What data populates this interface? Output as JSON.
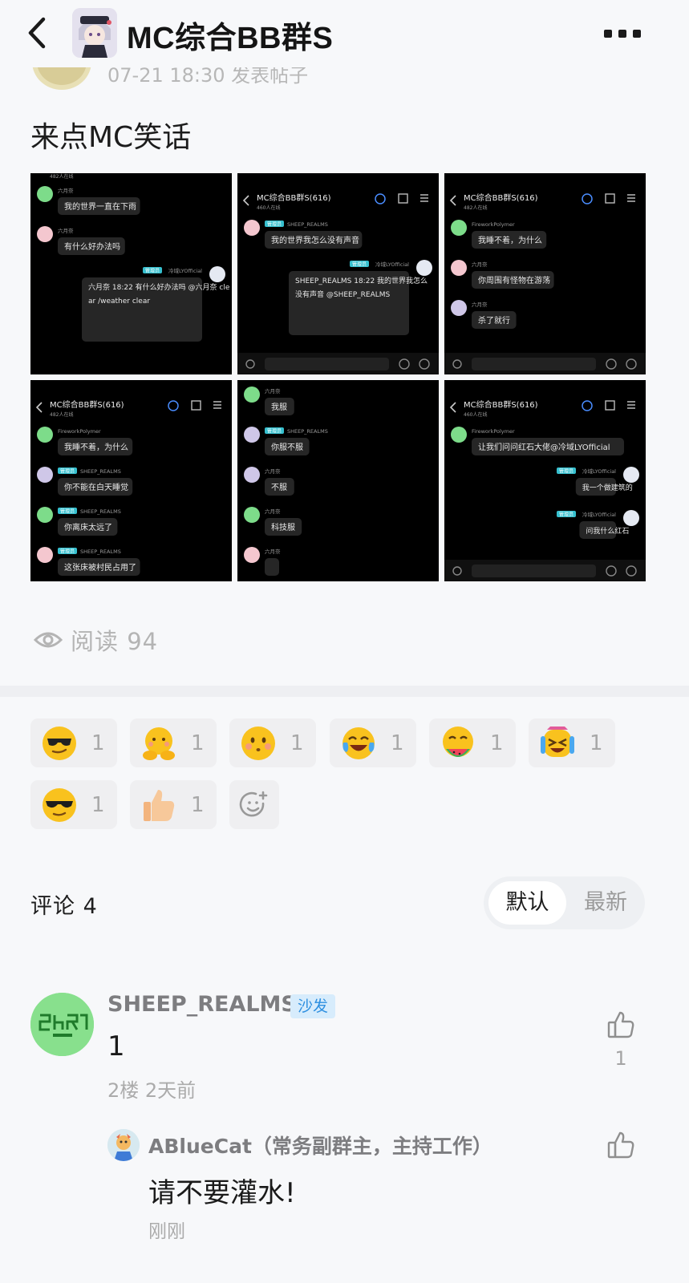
{
  "header": {
    "title": "MC综合BB群S",
    "back_icon": "chevron-left-icon",
    "more_icon": "more-dots-icon"
  },
  "post": {
    "time_partial": "07-21 18:30 发表帖子",
    "title": "来点MC笑话",
    "read_icon": "eye-icon",
    "read_label": "阅读 94",
    "screenshots": [
      {
        "chat_title": "",
        "online": "482人在线",
        "messages": [
          {
            "side": "left",
            "tag": "",
            "sender": "六月奈",
            "text": "我的世界一直在下雨"
          },
          {
            "side": "left",
            "tag": "",
            "sender": "六月奈",
            "text": "有什么好办法吗"
          },
          {
            "side": "right",
            "tag": "管理员",
            "sender": "冷域LYOfficial",
            "text": "六月奈 18:22 有什么好办法吗 @六月奈 clear /weather clear"
          }
        ]
      },
      {
        "chat_title": "MC综合BB群S(616)",
        "online": "460人在线",
        "messages": [
          {
            "side": "left",
            "tag": "管理员",
            "sender": "SHEEP_REALMS",
            "text": "我的世界我怎么没有声音"
          },
          {
            "side": "right",
            "tag": "管理员",
            "sender": "冷域LYOfficial",
            "text": "SHEEP_REALMS 18:22 我的世界我怎么没有声音 @SHEEP_REALMS"
          }
        ]
      },
      {
        "chat_title": "MC综合BB群S(616)",
        "online": "482人在线",
        "messages": [
          {
            "side": "left",
            "tag": "",
            "sender": "FireworkPolymer",
            "text": "我睡不着，为什么"
          },
          {
            "side": "left",
            "tag": "",
            "sender": "六月奈",
            "text": "你周围有怪物在游荡"
          },
          {
            "side": "left",
            "tag": "",
            "sender": "六月奈",
            "text": "杀了就行"
          }
        ]
      },
      {
        "chat_title": "MC综合BB群S(616)",
        "online": "482人在线",
        "messages": [
          {
            "side": "left",
            "tag": "",
            "sender": "FireworkPolymer",
            "text": "我睡不着，为什么"
          },
          {
            "side": "left",
            "tag": "管理员",
            "sender": "SHEEP_REALMS",
            "text": "你不能在白天睡觉"
          },
          {
            "side": "left",
            "tag": "管理员",
            "sender": "SHEEP_REALMS",
            "text": "你离床太远了"
          },
          {
            "side": "left",
            "tag": "管理员",
            "sender": "SHEEP_REALMS",
            "text": "这张床被村民占用了"
          }
        ]
      },
      {
        "chat_title": "",
        "online": "",
        "messages": [
          {
            "side": "left",
            "tag": "",
            "sender": "六月奈",
            "text": "我服"
          },
          {
            "side": "left",
            "tag": "管理员",
            "sender": "SHEEP_REALMS",
            "text": "你服不服"
          },
          {
            "side": "left",
            "tag": "",
            "sender": "六月奈",
            "text": "不服"
          },
          {
            "side": "left",
            "tag": "",
            "sender": "六月奈",
            "text": "科技服"
          },
          {
            "side": "left",
            "tag": "",
            "sender": "六月奈",
            "text": ""
          }
        ]
      },
      {
        "chat_title": "MC综合BB群S(616)",
        "online": "460人在线",
        "messages": [
          {
            "side": "left",
            "tag": "",
            "sender": "FireworkPolymer",
            "text": "让我们问问红石大佬@冷域LYOfficial"
          },
          {
            "side": "right",
            "tag": "管理员",
            "sender": "冷域LYOfficial",
            "text": "我一个做建筑的"
          },
          {
            "side": "right",
            "tag": "管理员",
            "sender": "冷域LYOfficial",
            "text": "问我什么红石"
          }
        ]
      }
    ]
  },
  "reactions": [
    {
      "emoji": "cool-face-emoji",
      "count": "1"
    },
    {
      "emoji": "shy-hands-emoji",
      "count": "1"
    },
    {
      "emoji": "blushing-face-emoji",
      "count": "1"
    },
    {
      "emoji": "tears-of-joy-emoji",
      "count": "1"
    },
    {
      "emoji": "eating-watermelon-emoji",
      "count": "1"
    },
    {
      "emoji": "crying-laughing-emoji",
      "count": "1"
    },
    {
      "emoji": "sunglasses-face-emoji",
      "count": "1"
    },
    {
      "emoji": "thumbs-up-emoji",
      "count": "1"
    },
    {
      "emoji": "add-reaction-icon",
      "count": ""
    }
  ],
  "comments": {
    "header": "评论 4",
    "sort_default": "默认",
    "sort_latest": "最新",
    "items": [
      {
        "author": "SHEEP_REALMS",
        "badge": "沙发",
        "text": "1",
        "meta": "2楼 2天前",
        "like_count": "1",
        "reply": {
          "author": "ABlueCat（常务副群主，主持工作）",
          "text": "请不要灌水!",
          "meta": "刚刚"
        }
      }
    ]
  },
  "colors": {
    "background": "#f7f8fa",
    "chip": "#efeff1",
    "badge_bg": "#d7ecfc",
    "badge_text": "#2d8fe0",
    "admin_tag": "#36c0cf"
  }
}
